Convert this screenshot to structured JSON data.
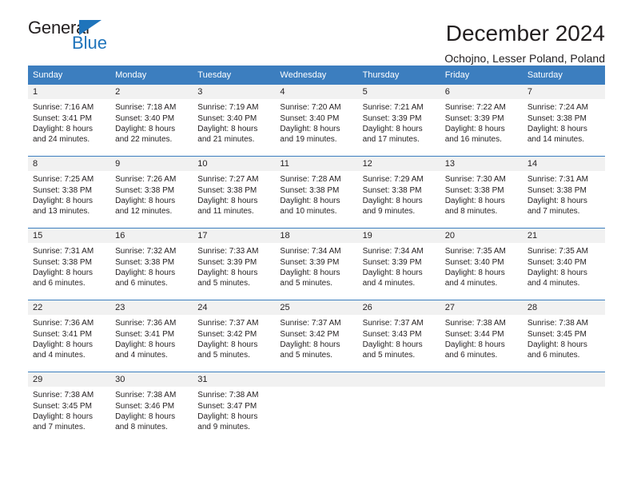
{
  "brand": {
    "name_top": "General",
    "name_bottom": "Blue",
    "accent_color": "#1f74bb"
  },
  "header": {
    "title": "December 2024",
    "subtitle": "Ochojno, Lesser Poland, Poland"
  },
  "calendar": {
    "header_bg": "#3c7ebf",
    "day_cell_bg": "#f1f1f1",
    "weekday_headers": [
      "Sunday",
      "Monday",
      "Tuesday",
      "Wednesday",
      "Thursday",
      "Friday",
      "Saturday"
    ],
    "weeks": [
      [
        {
          "day": "1",
          "sunrise": "Sunrise: 7:16 AM",
          "sunset": "Sunset: 3:41 PM",
          "daylight_1": "Daylight: 8 hours",
          "daylight_2": "and 24 minutes."
        },
        {
          "day": "2",
          "sunrise": "Sunrise: 7:18 AM",
          "sunset": "Sunset: 3:40 PM",
          "daylight_1": "Daylight: 8 hours",
          "daylight_2": "and 22 minutes."
        },
        {
          "day": "3",
          "sunrise": "Sunrise: 7:19 AM",
          "sunset": "Sunset: 3:40 PM",
          "daylight_1": "Daylight: 8 hours",
          "daylight_2": "and 21 minutes."
        },
        {
          "day": "4",
          "sunrise": "Sunrise: 7:20 AM",
          "sunset": "Sunset: 3:40 PM",
          "daylight_1": "Daylight: 8 hours",
          "daylight_2": "and 19 minutes."
        },
        {
          "day": "5",
          "sunrise": "Sunrise: 7:21 AM",
          "sunset": "Sunset: 3:39 PM",
          "daylight_1": "Daylight: 8 hours",
          "daylight_2": "and 17 minutes."
        },
        {
          "day": "6",
          "sunrise": "Sunrise: 7:22 AM",
          "sunset": "Sunset: 3:39 PM",
          "daylight_1": "Daylight: 8 hours",
          "daylight_2": "and 16 minutes."
        },
        {
          "day": "7",
          "sunrise": "Sunrise: 7:24 AM",
          "sunset": "Sunset: 3:38 PM",
          "daylight_1": "Daylight: 8 hours",
          "daylight_2": "and 14 minutes."
        }
      ],
      [
        {
          "day": "8",
          "sunrise": "Sunrise: 7:25 AM",
          "sunset": "Sunset: 3:38 PM",
          "daylight_1": "Daylight: 8 hours",
          "daylight_2": "and 13 minutes."
        },
        {
          "day": "9",
          "sunrise": "Sunrise: 7:26 AM",
          "sunset": "Sunset: 3:38 PM",
          "daylight_1": "Daylight: 8 hours",
          "daylight_2": "and 12 minutes."
        },
        {
          "day": "10",
          "sunrise": "Sunrise: 7:27 AM",
          "sunset": "Sunset: 3:38 PM",
          "daylight_1": "Daylight: 8 hours",
          "daylight_2": "and 11 minutes."
        },
        {
          "day": "11",
          "sunrise": "Sunrise: 7:28 AM",
          "sunset": "Sunset: 3:38 PM",
          "daylight_1": "Daylight: 8 hours",
          "daylight_2": "and 10 minutes."
        },
        {
          "day": "12",
          "sunrise": "Sunrise: 7:29 AM",
          "sunset": "Sunset: 3:38 PM",
          "daylight_1": "Daylight: 8 hours",
          "daylight_2": "and 9 minutes."
        },
        {
          "day": "13",
          "sunrise": "Sunrise: 7:30 AM",
          "sunset": "Sunset: 3:38 PM",
          "daylight_1": "Daylight: 8 hours",
          "daylight_2": "and 8 minutes."
        },
        {
          "day": "14",
          "sunrise": "Sunrise: 7:31 AM",
          "sunset": "Sunset: 3:38 PM",
          "daylight_1": "Daylight: 8 hours",
          "daylight_2": "and 7 minutes."
        }
      ],
      [
        {
          "day": "15",
          "sunrise": "Sunrise: 7:31 AM",
          "sunset": "Sunset: 3:38 PM",
          "daylight_1": "Daylight: 8 hours",
          "daylight_2": "and 6 minutes."
        },
        {
          "day": "16",
          "sunrise": "Sunrise: 7:32 AM",
          "sunset": "Sunset: 3:38 PM",
          "daylight_1": "Daylight: 8 hours",
          "daylight_2": "and 6 minutes."
        },
        {
          "day": "17",
          "sunrise": "Sunrise: 7:33 AM",
          "sunset": "Sunset: 3:39 PM",
          "daylight_1": "Daylight: 8 hours",
          "daylight_2": "and 5 minutes."
        },
        {
          "day": "18",
          "sunrise": "Sunrise: 7:34 AM",
          "sunset": "Sunset: 3:39 PM",
          "daylight_1": "Daylight: 8 hours",
          "daylight_2": "and 5 minutes."
        },
        {
          "day": "19",
          "sunrise": "Sunrise: 7:34 AM",
          "sunset": "Sunset: 3:39 PM",
          "daylight_1": "Daylight: 8 hours",
          "daylight_2": "and 4 minutes."
        },
        {
          "day": "20",
          "sunrise": "Sunrise: 7:35 AM",
          "sunset": "Sunset: 3:40 PM",
          "daylight_1": "Daylight: 8 hours",
          "daylight_2": "and 4 minutes."
        },
        {
          "day": "21",
          "sunrise": "Sunrise: 7:35 AM",
          "sunset": "Sunset: 3:40 PM",
          "daylight_1": "Daylight: 8 hours",
          "daylight_2": "and 4 minutes."
        }
      ],
      [
        {
          "day": "22",
          "sunrise": "Sunrise: 7:36 AM",
          "sunset": "Sunset: 3:41 PM",
          "daylight_1": "Daylight: 8 hours",
          "daylight_2": "and 4 minutes."
        },
        {
          "day": "23",
          "sunrise": "Sunrise: 7:36 AM",
          "sunset": "Sunset: 3:41 PM",
          "daylight_1": "Daylight: 8 hours",
          "daylight_2": "and 4 minutes."
        },
        {
          "day": "24",
          "sunrise": "Sunrise: 7:37 AM",
          "sunset": "Sunset: 3:42 PM",
          "daylight_1": "Daylight: 8 hours",
          "daylight_2": "and 5 minutes."
        },
        {
          "day": "25",
          "sunrise": "Sunrise: 7:37 AM",
          "sunset": "Sunset: 3:42 PM",
          "daylight_1": "Daylight: 8 hours",
          "daylight_2": "and 5 minutes."
        },
        {
          "day": "26",
          "sunrise": "Sunrise: 7:37 AM",
          "sunset": "Sunset: 3:43 PM",
          "daylight_1": "Daylight: 8 hours",
          "daylight_2": "and 5 minutes."
        },
        {
          "day": "27",
          "sunrise": "Sunrise: 7:38 AM",
          "sunset": "Sunset: 3:44 PM",
          "daylight_1": "Daylight: 8 hours",
          "daylight_2": "and 6 minutes."
        },
        {
          "day": "28",
          "sunrise": "Sunrise: 7:38 AM",
          "sunset": "Sunset: 3:45 PM",
          "daylight_1": "Daylight: 8 hours",
          "daylight_2": "and 6 minutes."
        }
      ],
      [
        {
          "day": "29",
          "sunrise": "Sunrise: 7:38 AM",
          "sunset": "Sunset: 3:45 PM",
          "daylight_1": "Daylight: 8 hours",
          "daylight_2": "and 7 minutes."
        },
        {
          "day": "30",
          "sunrise": "Sunrise: 7:38 AM",
          "sunset": "Sunset: 3:46 PM",
          "daylight_1": "Daylight: 8 hours",
          "daylight_2": "and 8 minutes."
        },
        {
          "day": "31",
          "sunrise": "Sunrise: 7:38 AM",
          "sunset": "Sunset: 3:47 PM",
          "daylight_1": "Daylight: 8 hours",
          "daylight_2": "and 9 minutes."
        },
        {
          "day": "",
          "sunrise": "",
          "sunset": "",
          "daylight_1": "",
          "daylight_2": ""
        },
        {
          "day": "",
          "sunrise": "",
          "sunset": "",
          "daylight_1": "",
          "daylight_2": ""
        },
        {
          "day": "",
          "sunrise": "",
          "sunset": "",
          "daylight_1": "",
          "daylight_2": ""
        },
        {
          "day": "",
          "sunrise": "",
          "sunset": "",
          "daylight_1": "",
          "daylight_2": ""
        }
      ]
    ]
  }
}
